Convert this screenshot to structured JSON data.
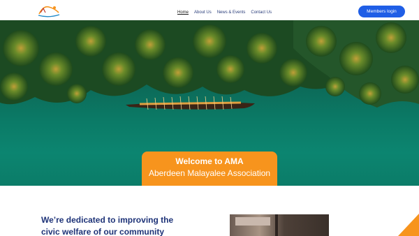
{
  "nav": {
    "items": [
      {
        "label": "Home",
        "active": true
      },
      {
        "label": "About Us",
        "active": false
      },
      {
        "label": "News & Events",
        "active": false
      },
      {
        "label": "Contact Us",
        "active": false
      }
    ]
  },
  "header": {
    "login_label": "Members login"
  },
  "hero": {
    "welcome_title": "Welcome to AMA",
    "welcome_subtitle": "Aberdeen Malayalee Association"
  },
  "mission": {
    "line1": "We’re dedicated to improving the",
    "line2": "civic welfare of our community"
  },
  "colors": {
    "accent": "#f7941d",
    "primary": "#1f5ee6",
    "heading": "#1e3378",
    "water": "#0b7a66"
  }
}
